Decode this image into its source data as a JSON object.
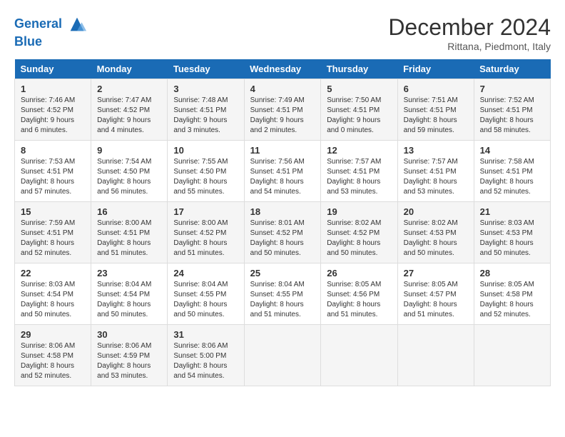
{
  "header": {
    "logo_line1": "General",
    "logo_line2": "Blue",
    "month": "December 2024",
    "location": "Rittana, Piedmont, Italy"
  },
  "days_of_week": [
    "Sunday",
    "Monday",
    "Tuesday",
    "Wednesday",
    "Thursday",
    "Friday",
    "Saturday"
  ],
  "weeks": [
    [
      {
        "day": "1",
        "info": "Sunrise: 7:46 AM\nSunset: 4:52 PM\nDaylight: 9 hours\nand 6 minutes."
      },
      {
        "day": "2",
        "info": "Sunrise: 7:47 AM\nSunset: 4:52 PM\nDaylight: 9 hours\nand 4 minutes."
      },
      {
        "day": "3",
        "info": "Sunrise: 7:48 AM\nSunset: 4:51 PM\nDaylight: 9 hours\nand 3 minutes."
      },
      {
        "day": "4",
        "info": "Sunrise: 7:49 AM\nSunset: 4:51 PM\nDaylight: 9 hours\nand 2 minutes."
      },
      {
        "day": "5",
        "info": "Sunrise: 7:50 AM\nSunset: 4:51 PM\nDaylight: 9 hours\nand 0 minutes."
      },
      {
        "day": "6",
        "info": "Sunrise: 7:51 AM\nSunset: 4:51 PM\nDaylight: 8 hours\nand 59 minutes."
      },
      {
        "day": "7",
        "info": "Sunrise: 7:52 AM\nSunset: 4:51 PM\nDaylight: 8 hours\nand 58 minutes."
      }
    ],
    [
      {
        "day": "8",
        "info": "Sunrise: 7:53 AM\nSunset: 4:51 PM\nDaylight: 8 hours\nand 57 minutes."
      },
      {
        "day": "9",
        "info": "Sunrise: 7:54 AM\nSunset: 4:50 PM\nDaylight: 8 hours\nand 56 minutes."
      },
      {
        "day": "10",
        "info": "Sunrise: 7:55 AM\nSunset: 4:50 PM\nDaylight: 8 hours\nand 55 minutes."
      },
      {
        "day": "11",
        "info": "Sunrise: 7:56 AM\nSunset: 4:51 PM\nDaylight: 8 hours\nand 54 minutes."
      },
      {
        "day": "12",
        "info": "Sunrise: 7:57 AM\nSunset: 4:51 PM\nDaylight: 8 hours\nand 53 minutes."
      },
      {
        "day": "13",
        "info": "Sunrise: 7:57 AM\nSunset: 4:51 PM\nDaylight: 8 hours\nand 53 minutes."
      },
      {
        "day": "14",
        "info": "Sunrise: 7:58 AM\nSunset: 4:51 PM\nDaylight: 8 hours\nand 52 minutes."
      }
    ],
    [
      {
        "day": "15",
        "info": "Sunrise: 7:59 AM\nSunset: 4:51 PM\nDaylight: 8 hours\nand 52 minutes."
      },
      {
        "day": "16",
        "info": "Sunrise: 8:00 AM\nSunset: 4:51 PM\nDaylight: 8 hours\nand 51 minutes."
      },
      {
        "day": "17",
        "info": "Sunrise: 8:00 AM\nSunset: 4:52 PM\nDaylight: 8 hours\nand 51 minutes."
      },
      {
        "day": "18",
        "info": "Sunrise: 8:01 AM\nSunset: 4:52 PM\nDaylight: 8 hours\nand 50 minutes."
      },
      {
        "day": "19",
        "info": "Sunrise: 8:02 AM\nSunset: 4:52 PM\nDaylight: 8 hours\nand 50 minutes."
      },
      {
        "day": "20",
        "info": "Sunrise: 8:02 AM\nSunset: 4:53 PM\nDaylight: 8 hours\nand 50 minutes."
      },
      {
        "day": "21",
        "info": "Sunrise: 8:03 AM\nSunset: 4:53 PM\nDaylight: 8 hours\nand 50 minutes."
      }
    ],
    [
      {
        "day": "22",
        "info": "Sunrise: 8:03 AM\nSunset: 4:54 PM\nDaylight: 8 hours\nand 50 minutes."
      },
      {
        "day": "23",
        "info": "Sunrise: 8:04 AM\nSunset: 4:54 PM\nDaylight: 8 hours\nand 50 minutes."
      },
      {
        "day": "24",
        "info": "Sunrise: 8:04 AM\nSunset: 4:55 PM\nDaylight: 8 hours\nand 50 minutes."
      },
      {
        "day": "25",
        "info": "Sunrise: 8:04 AM\nSunset: 4:55 PM\nDaylight: 8 hours\nand 51 minutes."
      },
      {
        "day": "26",
        "info": "Sunrise: 8:05 AM\nSunset: 4:56 PM\nDaylight: 8 hours\nand 51 minutes."
      },
      {
        "day": "27",
        "info": "Sunrise: 8:05 AM\nSunset: 4:57 PM\nDaylight: 8 hours\nand 51 minutes."
      },
      {
        "day": "28",
        "info": "Sunrise: 8:05 AM\nSunset: 4:58 PM\nDaylight: 8 hours\nand 52 minutes."
      }
    ],
    [
      {
        "day": "29",
        "info": "Sunrise: 8:06 AM\nSunset: 4:58 PM\nDaylight: 8 hours\nand 52 minutes."
      },
      {
        "day": "30",
        "info": "Sunrise: 8:06 AM\nSunset: 4:59 PM\nDaylight: 8 hours\nand 53 minutes."
      },
      {
        "day": "31",
        "info": "Sunrise: 8:06 AM\nSunset: 5:00 PM\nDaylight: 8 hours\nand 54 minutes."
      },
      {
        "day": "",
        "info": ""
      },
      {
        "day": "",
        "info": ""
      },
      {
        "day": "",
        "info": ""
      },
      {
        "day": "",
        "info": ""
      }
    ]
  ]
}
